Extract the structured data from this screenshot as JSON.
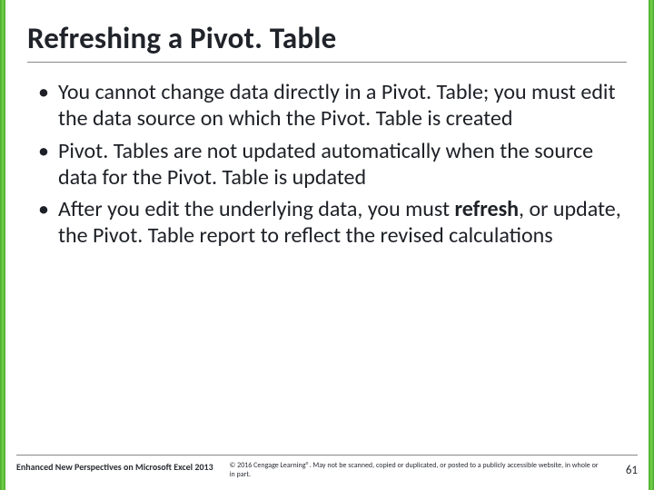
{
  "title": "Refreshing a Pivot. Table",
  "bullets": [
    {
      "prefix": "You cannot change data directly in a Pivot. Table; you must edit the data source on which the Pivot. Table is created",
      "strong": "",
      "suffix": ""
    },
    {
      "prefix": "Pivot. Tables are not updated automatically when the source data for the Pivot. Table is updated",
      "strong": "",
      "suffix": ""
    },
    {
      "prefix": "After you edit the underlying data, you must ",
      "strong": "refresh",
      "suffix": ", or update, the Pivot. Table report to reflect the revised calculations"
    }
  ],
  "footer": {
    "book": "Enhanced New Perspectives on Microsoft Excel 2013",
    "copyright": "© 2016 Cengage Learning®. May not be scanned, copied or duplicated, or posted to a publicly accessible website, in whole or in part.",
    "page": "61"
  }
}
